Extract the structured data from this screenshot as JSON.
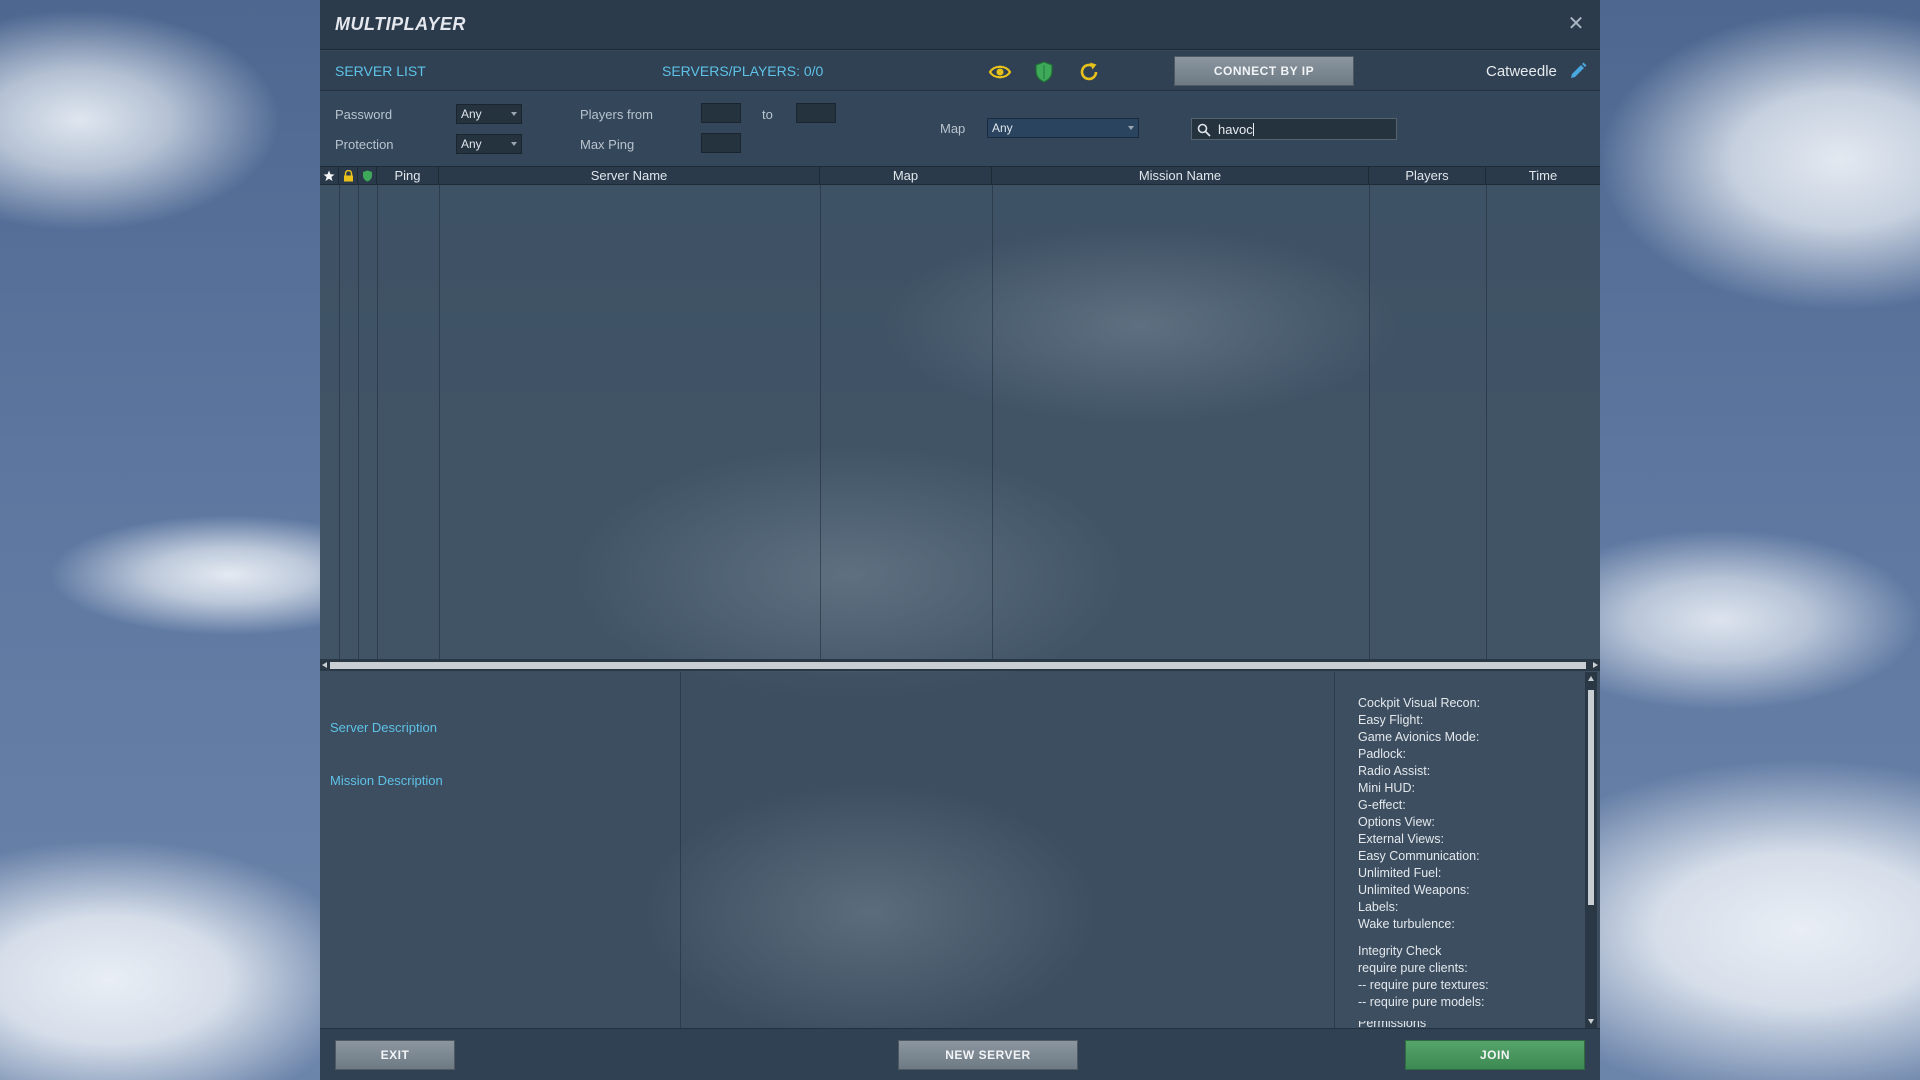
{
  "window": {
    "title": "MULTIPLAYER"
  },
  "toolbar": {
    "server_list_label": "SERVER LIST",
    "server_count": "SERVERS/PLAYERS: 0/0",
    "connect_label": "CONNECT BY IP",
    "username": "Catweedle",
    "icons": [
      "eye-icon",
      "shield-icon",
      "refresh-icon",
      "pencil-icon"
    ]
  },
  "filters": {
    "password_label": "Password",
    "password_value": "Any",
    "protection_label": "Protection",
    "protection_value": "Any",
    "players_from_label": "Players from",
    "players_to_label": "to",
    "max_ping_label": "Max Ping",
    "map_label": "Map",
    "map_value": "Any",
    "search_value": "havoc"
  },
  "table": {
    "columns": [
      "Ping",
      "Server Name",
      "Map",
      "Mission Name",
      "Players",
      "Time"
    ],
    "rows": []
  },
  "details": {
    "server_description_label": "Server Description",
    "mission_description_label": "Mission Description",
    "options": [
      "Cockpit Visual Recon:",
      "Easy Flight:",
      "Game Avionics Mode:",
      "Padlock:",
      "Radio Assist:",
      "Mini HUD:",
      "G-effect:",
      "Options View:",
      "External Views:",
      "Easy Communication:",
      "Unlimited Fuel:",
      "Unlimited Weapons:",
      "Labels:",
      "Wake turbulence:"
    ],
    "integrity": [
      "Integrity Check",
      "require pure clients:",
      "-- require pure textures:",
      "-- require pure models:"
    ],
    "permissions_label": "Permissions"
  },
  "footer": {
    "exit_label": "EXIT",
    "new_server_label": "NEW SERVER",
    "join_label": "JOIN"
  },
  "colors": {
    "accent_text": "#5fc2e8",
    "icon_yellow": "#e8c21a",
    "icon_green": "#3fa95a",
    "join_green": "#4a9a60"
  }
}
